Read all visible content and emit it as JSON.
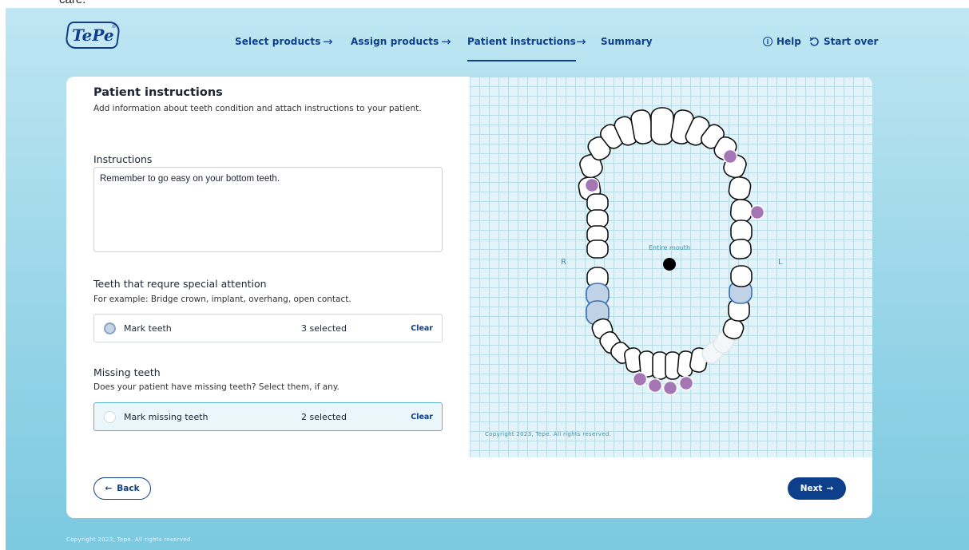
{
  "top_fragment": "care.",
  "header": {
    "logo": "TePe",
    "logo_mark": "®",
    "steps": [
      {
        "label": "Select products",
        "active": false
      },
      {
        "label": "Assign products",
        "active": false
      },
      {
        "label": "Patient instructions",
        "active": true
      },
      {
        "label": "Summary",
        "active": false
      }
    ],
    "step_arrow": "→",
    "help": "Help",
    "help_icon": "info-circle-icon",
    "start_over": "Start over",
    "start_over_icon": "refresh-icon"
  },
  "panel": {
    "title": "Patient instructions",
    "description": "Add information about teeth condition and attach instructions to your patient.",
    "instructions_label": "Instructions",
    "instructions_value": "Remember to go easy on your bottom teeth.",
    "attention": {
      "title": "Teeth that requre special attention",
      "subtitle": "For example: Bridge crown, implant, overhang, open contact.",
      "option_label": "Mark teeth",
      "count": "3 selected",
      "clear": "Clear"
    },
    "missing": {
      "title": "Missing teeth",
      "subtitle": "Does your patient have missing teeth? Select them, if any.",
      "option_label": "Mark missing teeth",
      "count": "2 selected",
      "clear": "Clear"
    }
  },
  "diagram": {
    "label_right": "R",
    "label_left": "L",
    "entire_mouth": "Entire mouth",
    "copyright": "Copyright 2023, Tepe. All rights reserved.",
    "colors": {
      "tooth_fill": "#ffffff",
      "tooth_stroke": "#111111",
      "attention_fill": "#c0d2e6",
      "attention_stroke": "#3b6fb0",
      "marker": "#a477b4",
      "missing_fill": "#f3f7f9"
    }
  },
  "footer": {
    "back": "Back",
    "back_icon": "arrow-left-icon",
    "next": "Next",
    "next_icon": "arrow-right-icon",
    "copyright": "Copyright 2023, Tepe. All rights reserved."
  }
}
